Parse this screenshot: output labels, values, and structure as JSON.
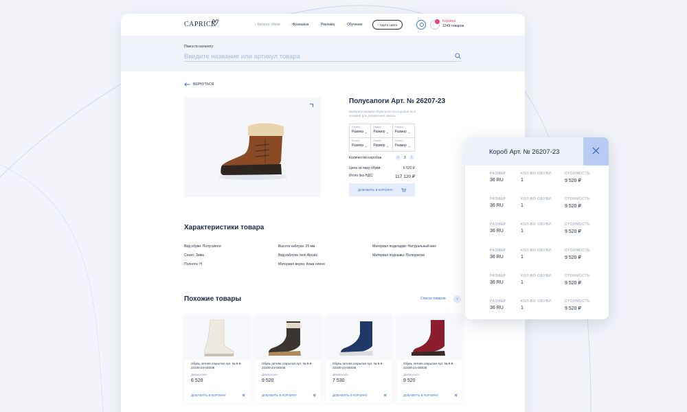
{
  "header": {
    "logo": "CAPRICE",
    "nav": [
      "Каталог обуви",
      "Франшиза",
      "Реклама",
      "Обучение"
    ],
    "sitemap_label": "Карта сайта",
    "cart_label": "Корзина",
    "cart_count": "1249 товаров"
  },
  "search": {
    "caption": "Поиск по каталогу",
    "placeholder": "Введите название или артикул товара"
  },
  "back_label": "вернуться",
  "product": {
    "title": "Полусапоги Арт. № 26207-23",
    "hint": "Выберите размер обуви и кол-во коробов по 6 позиций для добавления заказа.",
    "size_cells": [
      {
        "caption": "Размер",
        "value": "Размер"
      },
      {
        "caption": "Размер",
        "value": "Размер"
      },
      {
        "caption": "Размер",
        "value": "Размер"
      },
      {
        "caption": "Размер",
        "value": "Размер"
      },
      {
        "caption": "Размер",
        "value": "Размер"
      },
      {
        "caption": "Размер",
        "value": "Размер"
      }
    ],
    "qty_label": "Количество коробов",
    "qty_value": "3",
    "price_pair_label": "Цена за пару обуви:",
    "price_pair_value": "6 520 ₽",
    "total_label": "Итого без НДС:",
    "total_value": "117 120 ₽",
    "add_label": "добавить в корзину"
  },
  "characteristics": {
    "title": "Характеристики товара",
    "items": [
      "Вид обуви: Полусапоги",
      "Высота каблука: 25 мм",
      "Материал подкладки: Натуральный мех",
      "Сезон: Зима",
      "Вид каблука: kein Absatz",
      "Материал подошвы: Полиуретан",
      "Полнота: H",
      "Материал верха: Кожа оленя"
    ]
  },
  "similar": {
    "title": "Похожие товары",
    "link": "Список товаров",
    "cards": [
      {
        "name": "Обувь летняя открытая Арт. № 9-9-22100-24-040/36",
        "season": "Демисезон",
        "price": "6 520",
        "add": "добавить в корзину"
      },
      {
        "name": "Обувь летняя открытая Арт. № 9-9-22100-24-040/36",
        "season": "Демисезон",
        "price": "9 520",
        "add": "добавить в корзину"
      },
      {
        "name": "Обувь летняя открытая Арт. № 9-9-22100-24-040/36",
        "season": "Демисезон",
        "price": "7 530",
        "add": "добавить в корзину"
      },
      {
        "name": "Обувь летняя открытая Арт. № 9-9-22100-24-040/36",
        "season": "Демисезон",
        "price": "9 520",
        "add": "добавить в корзину"
      }
    ]
  },
  "box_panel": {
    "title": "Короб Арт. № 26207-23",
    "headers": [
      "размер",
      "кол-во обуви",
      "стоимость"
    ],
    "rows": [
      [
        "36 RU",
        "1",
        "9 520 ₽"
      ],
      [
        "36 RU",
        "1",
        "9 520 ₽"
      ],
      [
        "36 RU",
        "1",
        "9 520 ₽"
      ],
      [
        "36 RU",
        "1",
        "9 520 ₽"
      ],
      [
        "36 RU",
        "1",
        "9 520 ₽"
      ],
      [
        "36 RU",
        "1",
        "9 520 ₽"
      ]
    ]
  },
  "colors": {
    "accent": "#3e6fd8",
    "badge": "#e6427c",
    "text": "#1d2a44",
    "close_button": "#b7cbf3"
  }
}
